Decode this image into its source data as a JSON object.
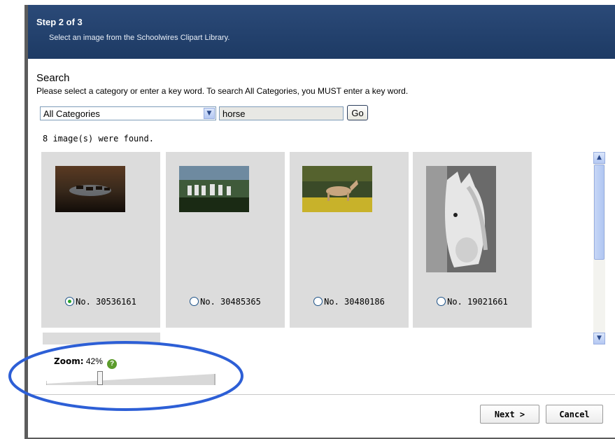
{
  "header": {
    "step": "Step 2 of 3",
    "subtitle": "Select an image from the Schoolwires Clipart Library."
  },
  "search": {
    "heading": "Search",
    "instructions": "Please select a category or enter a key word. To search All Categories, you MUST enter a key word.",
    "category_value": "All Categories",
    "keyword_value": "horse",
    "go_label": "Go"
  },
  "results": {
    "found_text": "8 image(s) were found.",
    "images": [
      {
        "label": "No. 30536161",
        "selected": true
      },
      {
        "label": "No. 30485365",
        "selected": false
      },
      {
        "label": "No. 30480186",
        "selected": false
      },
      {
        "label": "No. 19021661",
        "selected": false
      }
    ]
  },
  "zoom": {
    "label": "Zoom:",
    "value_text": "42%",
    "level": 0.42,
    "help_glyph": "?"
  },
  "footer": {
    "next_label": "Next >",
    "cancel_label": "Cancel"
  },
  "colors": {
    "header_bg": "#1d3a64",
    "card_bg": "#dcdcdc",
    "annotation_circle": "#2d5fd6",
    "selected_radio": "#2aa32a"
  },
  "icons": {
    "dropdown": "chevron-down-icon",
    "scroll_up": "chevron-up-icon",
    "scroll_down": "chevron-down-icon",
    "help": "help-icon"
  }
}
